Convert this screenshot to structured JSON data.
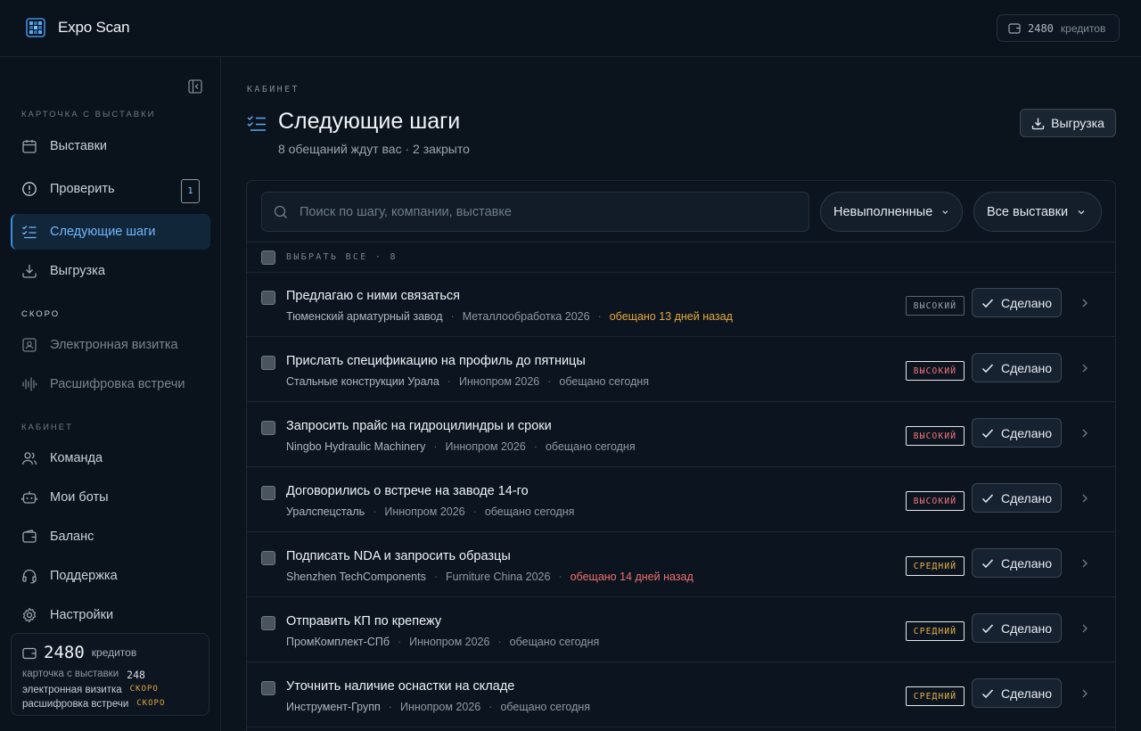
{
  "app": {
    "title": "Expo Scan",
    "logo_icon": "grid-scan-icon"
  },
  "topbar": {
    "credits_value": "2480",
    "credits_label": "кредитов"
  },
  "sidebar": {
    "sections": [
      {
        "label": "КАРТОЧКА С ВЫСТАВКИ"
      },
      {
        "label": "СКОРО"
      },
      {
        "label": "КАБИНЕТ"
      }
    ],
    "items": [
      {
        "label": "Выставки",
        "icon": "calendar-icon"
      },
      {
        "label": "Проверить",
        "icon": "alert-circle-icon",
        "badge": "1"
      },
      {
        "label": "Следующие шаги",
        "icon": "checklist-icon",
        "active": true
      },
      {
        "label": "Выгрузка",
        "icon": "download-icon"
      },
      {
        "label": "Электронная визитка",
        "icon": "contact-card-icon"
      },
      {
        "label": "Расшифровка встречи",
        "icon": "audio-wave-icon"
      },
      {
        "label": "Команда",
        "icon": "users-icon"
      },
      {
        "label": "Мои боты",
        "icon": "bot-icon"
      },
      {
        "label": "Баланс",
        "icon": "wallet-icon"
      },
      {
        "label": "Поддержка",
        "icon": "headset-icon"
      },
      {
        "label": "Настройки",
        "icon": "gear-icon"
      }
    ],
    "credits_card": {
      "value": "2480",
      "label": "кредитов",
      "lines": [
        {
          "name": "карточка с выставки",
          "value": "248"
        },
        {
          "name": "электронная визитка",
          "value": "СКОРО"
        },
        {
          "name": "расшифровка встречи",
          "value": "СКОРО"
        }
      ]
    }
  },
  "main": {
    "breadcrumb": "КАБИНЕТ",
    "title": "Следующие шаги",
    "subtitle": "8 обещаний ждут вас · 2 закрыто",
    "export_label": "Выгрузка",
    "search_placeholder": "Поиск по шагу, компании, выставке",
    "filter_status": "Невыполненные",
    "filter_events": "Все выставки",
    "select_all_label": "ВЫБРАТЬ ВСЕ · 8",
    "done_label": "Сделано",
    "tasks": [
      {
        "title": "Предлагаю с ними связаться",
        "company": "Тюменский арматурный завод",
        "event": "Металлообработка 2026",
        "due": "обещано 13 дней назад",
        "due_state": "warn",
        "priority": "ВЫСОКИЙ",
        "priority_style": "gray"
      },
      {
        "title": "Прислать спецификацию на профиль до пятницы",
        "company": "Стальные конструкции Урала",
        "event": "Иннопром 2026",
        "due": "обещано сегодня",
        "due_state": "normal",
        "priority": "ВЫСОКИЙ",
        "priority_style": "red"
      },
      {
        "title": "Запросить прайс на гидроцилиндры и сроки",
        "company": "Ningbo Hydraulic Machinery",
        "event": "Иннопром 2026",
        "due": "обещано сегодня",
        "due_state": "normal",
        "priority": "ВЫСОКИЙ",
        "priority_style": "red"
      },
      {
        "title": "Договорились о встрече на заводе 14-го",
        "company": "Уралспецсталь",
        "event": "Иннопром 2026",
        "due": "обещано сегодня",
        "due_state": "normal",
        "priority": "ВЫСОКИЙ",
        "priority_style": "red"
      },
      {
        "title": "Подписать NDA и запросить образцы",
        "company": "Shenzhen TechComponents",
        "event": "Furniture China 2026",
        "due": "обещано 14 дней назад",
        "due_state": "late",
        "priority": "СРЕДНИЙ",
        "priority_style": "amber"
      },
      {
        "title": "Отправить КП по крепежу",
        "company": "ПромКомплект-СПб",
        "event": "Иннопром 2026",
        "due": "обещано сегодня",
        "due_state": "normal",
        "priority": "СРЕДНИЙ",
        "priority_style": "amber"
      },
      {
        "title": "Уточнить наличие оснастки на складе",
        "company": "Инструмент-Групп",
        "event": "Иннопром 2026",
        "due": "обещано сегодня",
        "due_state": "normal",
        "priority": "СРЕДНИЙ",
        "priority_style": "amber"
      }
    ]
  }
}
